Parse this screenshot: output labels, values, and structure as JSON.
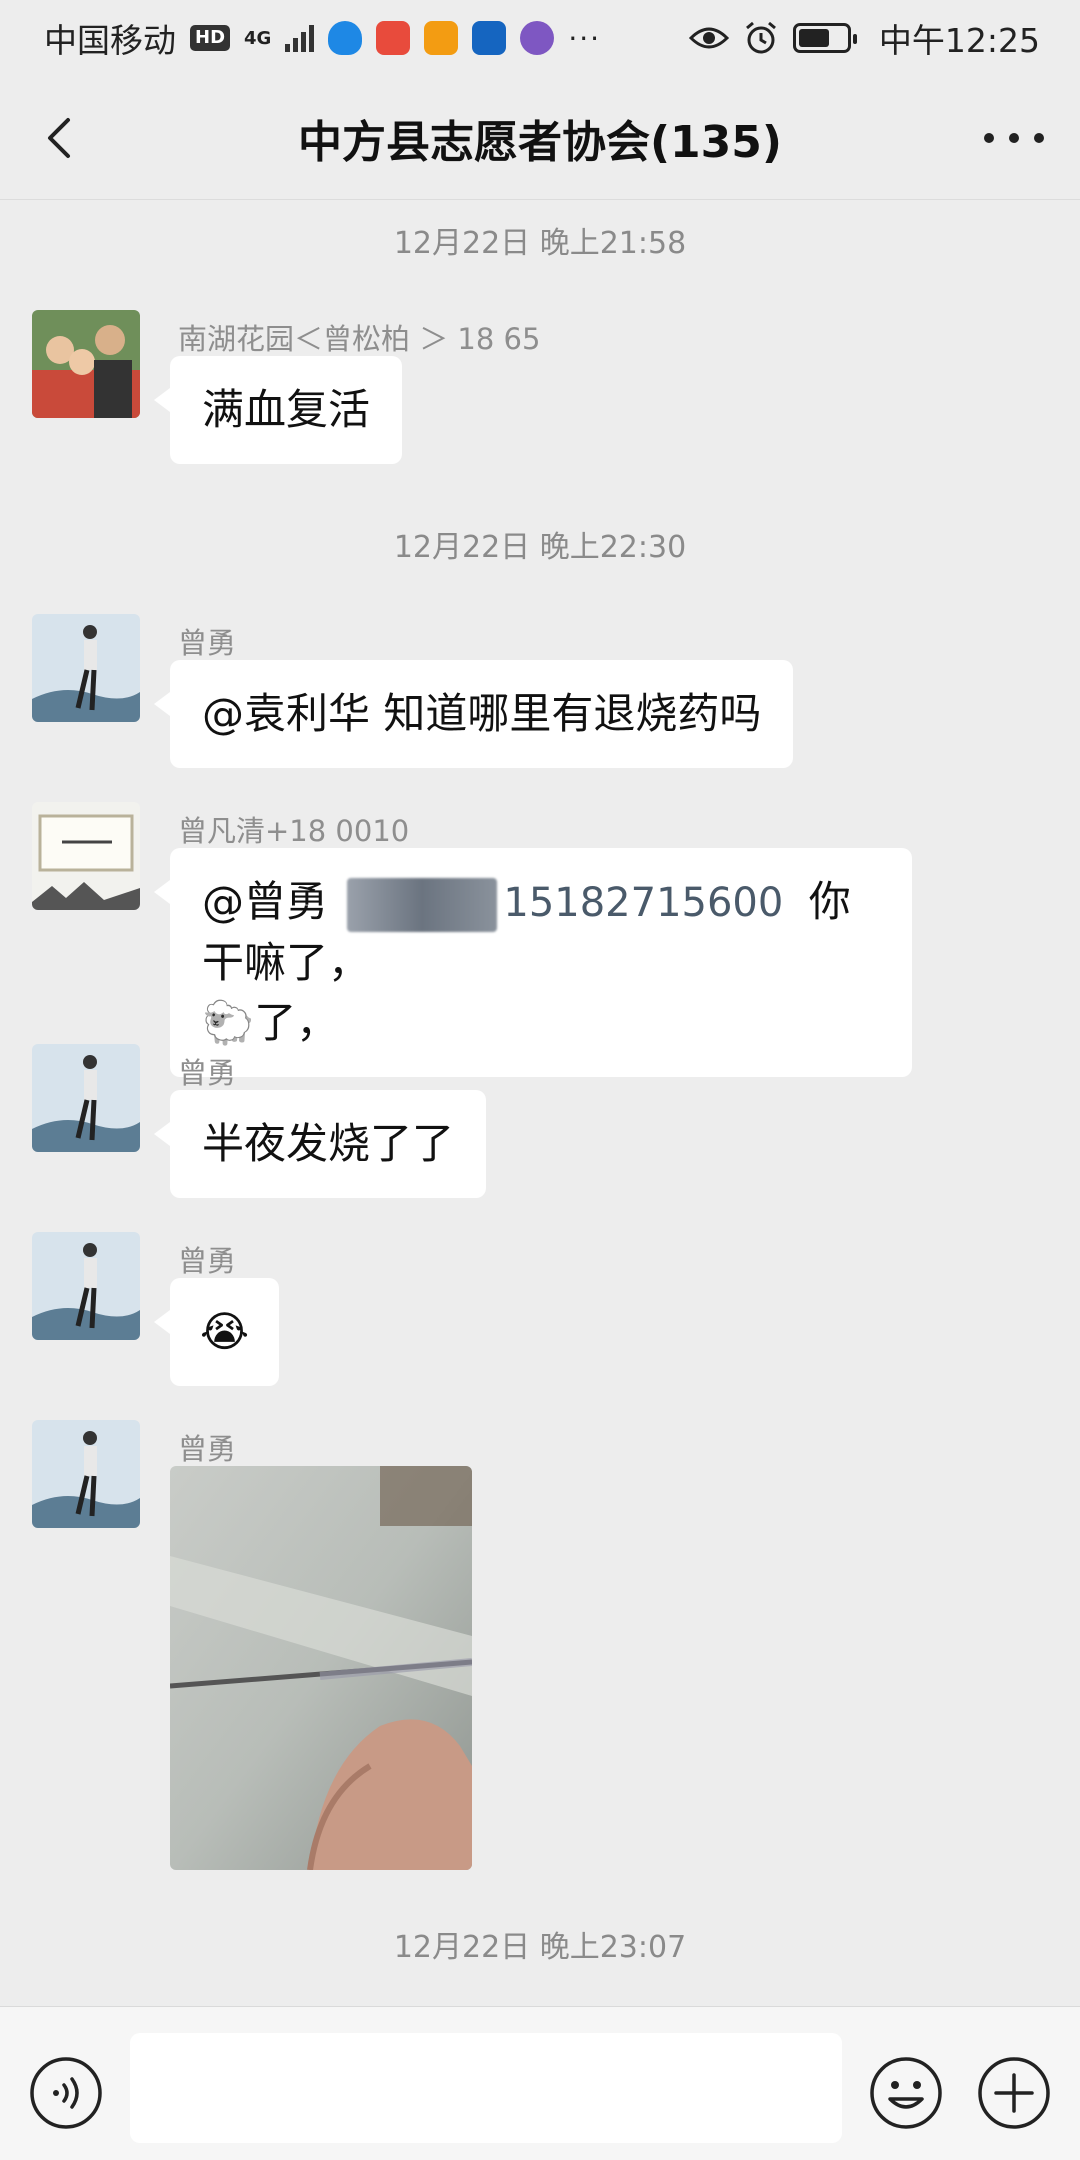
{
  "status_bar": {
    "carrier": "中国移动",
    "hd": "HD",
    "network": "4G",
    "more": "···",
    "time": "中午12:25"
  },
  "header": {
    "title": "中方县志愿者协会(135)"
  },
  "messages": [
    {
      "type": "timestamp",
      "text": "12月22日 晚上21:58"
    },
    {
      "type": "text",
      "sender": "南湖花园＜曾松柏 ＞ 18        65",
      "text": "满血复活"
    },
    {
      "type": "timestamp",
      "text": "12月22日 晚上22:30"
    },
    {
      "type": "text",
      "sender": "曾勇",
      "text": "@袁利华  知道哪里有退烧药吗"
    },
    {
      "type": "text",
      "sender": "曾凡清+18      0010",
      "text_a": "@曾勇",
      "text_blur": "15182715600",
      "text_b": "你干嘛了，",
      "emoji": "🐑",
      "text_c": "了，"
    },
    {
      "type": "text",
      "sender": "曾勇",
      "text": "半夜发烧了了"
    },
    {
      "type": "emoji",
      "sender": "曾勇",
      "text": "😭"
    },
    {
      "type": "image",
      "sender": "曾勇"
    },
    {
      "type": "timestamp",
      "text": "12月22日 晚上23:07"
    }
  ],
  "input_bar": {
    "placeholder": ""
  }
}
